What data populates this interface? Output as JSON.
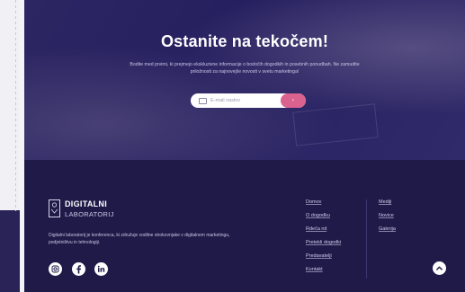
{
  "hero": {
    "title": "Ostanite na tekočem!",
    "description": "Bodite med prvimi, ki prejmejo ekskluzivne informacije o bodočih dogodkih in posebnih ponudbah. Ne zamudite priložnosti za najnovejše novosti v svetu marketinga!",
    "email_placeholder": "E-mail naslov",
    "submit_icon": "chevron-right-icon"
  },
  "footer": {
    "logo": {
      "name": "DIGITALNI",
      "sub": "LABORATORIJ"
    },
    "description": "Digitalni laboratorij je konferenca, ki združuje vodilne strokovnjake v digitalnem marketingu, podjetništvu in tehnologiji.",
    "social": [
      {
        "icon": "instagram-icon"
      },
      {
        "icon": "facebook-icon"
      },
      {
        "icon": "linkedin-icon"
      }
    ],
    "nav_primary": [
      "Domov",
      "O dogodku",
      "Rdeča nit",
      "Pretekli dogodki",
      "Predavatelji",
      "Kontakt"
    ],
    "nav_secondary": [
      "Mediji",
      "Novice",
      "Galerija"
    ],
    "back_to_top_icon": "chevron-up-icon"
  },
  "colors": {
    "hero_bg": "#2a2461",
    "footer_bg": "#1f1a48",
    "accent": "#d9628f",
    "text_light": "#ffffff"
  }
}
